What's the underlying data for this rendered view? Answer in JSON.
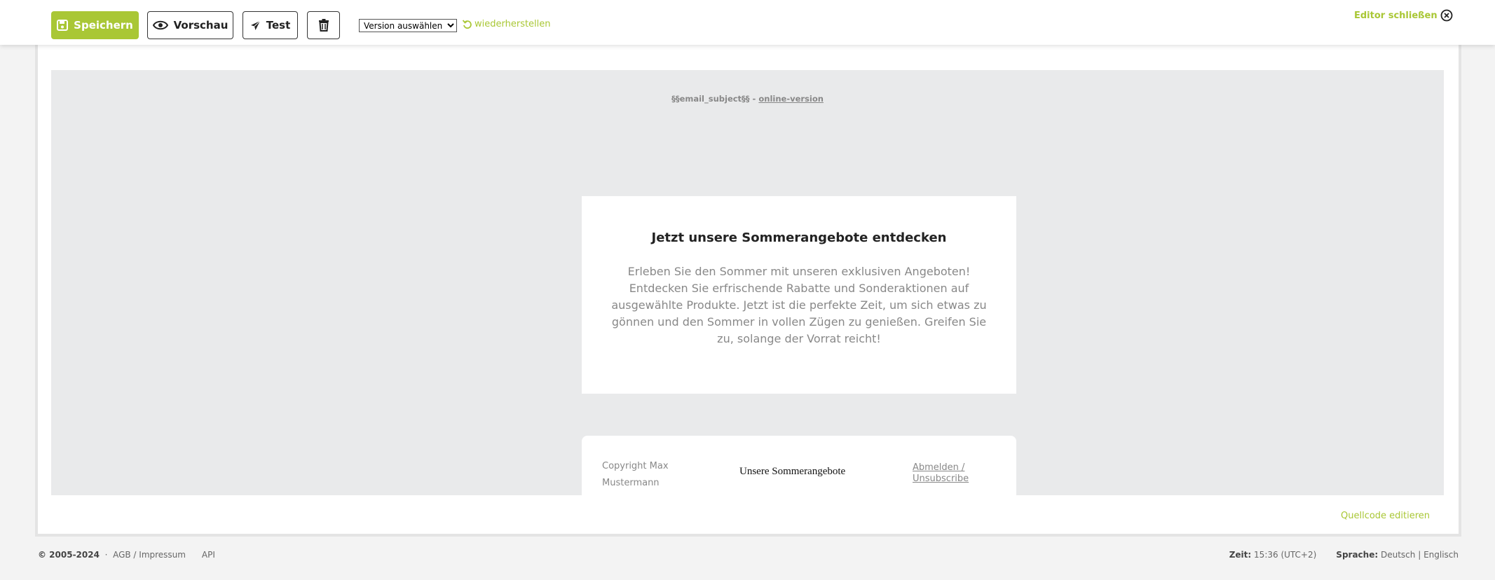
{
  "toolbar": {
    "save_label": "Speichern",
    "preview_label": "Vorschau",
    "test_label": "Test",
    "version_select": "Version auswählen",
    "restore_label": "wiederherstellen",
    "close_label": "Editor schließen",
    "accent": "#a9c735"
  },
  "email": {
    "preheader_subject": "§§email_subject§§ -",
    "preheader_link": "online-version",
    "headline": "Jetzt unsere Sommerangebote entdecken",
    "body": "Erleben Sie den Sommer mit unseren exklusiven Angeboten! Entdecken Sie erfrischende Rabatte und Sonderaktionen auf ausgewählte Produkte. Jetzt ist die perfekte Zeit, um sich etwas zu gönnen und den Sommer in vollen Zügen zu genießen. Greifen Sie zu, solange der Vorrat reicht!",
    "footer_copyright": "Copyright Max Mustermann",
    "footer_title": "Unsere Sommerangebote",
    "footer_unsubscribe": "Abmelden / Unsubscribe"
  },
  "panel": {
    "source_edit_label": "Quellcode editieren"
  },
  "footer": {
    "copyright": "© 2005-2024",
    "separator": "·",
    "agb_link": "AGB / Impressum",
    "api_link": "API",
    "time_label": "Zeit:",
    "time_value": "15:36 (UTC+2)",
    "language_label": "Sprache:",
    "language_de": "Deutsch",
    "language_sep": "|",
    "language_en": "Englisch"
  },
  "icons": {
    "save": "floppy-disk-icon",
    "preview": "eye-icon",
    "test": "paper-plane-icon",
    "delete": "trash-icon",
    "restore": "undo-icon",
    "close": "close-circle-icon"
  }
}
